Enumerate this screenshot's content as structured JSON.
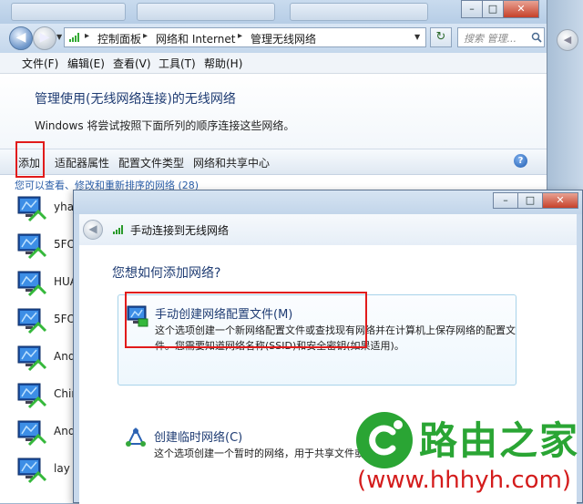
{
  "main_window": {
    "breadcrumbs": [
      "控制面板",
      "网络和 Internet",
      "管理无线网络"
    ],
    "search_placeholder": "搜索 管理...",
    "menu": [
      "文件(F)",
      "编辑(E)",
      "查看(V)",
      "工具(T)",
      "帮助(H)"
    ],
    "title": "管理使用(无线网络连接)的无线网络",
    "description": "Windows 将尝试按照下面所列的顺序连接这些网络。",
    "commands": [
      "添加",
      "适配器属性",
      "配置文件类型",
      "网络和共享中心"
    ],
    "network_count_text": "您可以查看、修改和重新排序的网络 (28)",
    "networks": [
      "yha",
      "5FO",
      "HUA",
      "5FO",
      "And",
      "Chin",
      "And",
      "lay"
    ]
  },
  "dialog": {
    "title": "手动连接到无线网络",
    "question": "您想如何添加网络?",
    "options": [
      {
        "title": "手动创建网络配置文件(M)",
        "description_line1": "这个选项创建一个新网络配置文件或查找现有网络并在计算机上保存网络的配置文",
        "description_line2": "件。您需要知道网络名称(SSID)和安全密钥(如果适用)。"
      },
      {
        "title": "创建临时网络(C)",
        "description_line1": "这个选项创建一个暂时的网络，用于共享文件或"
      }
    ]
  },
  "watermark": {
    "name": "路由之家",
    "url": "(www.hhhyh.com)"
  },
  "colors": {
    "highlight": "#e11b1b",
    "title_blue": "#1f3c73",
    "watermark_green": "#2aa534",
    "watermark_red": "#d41c1c"
  }
}
